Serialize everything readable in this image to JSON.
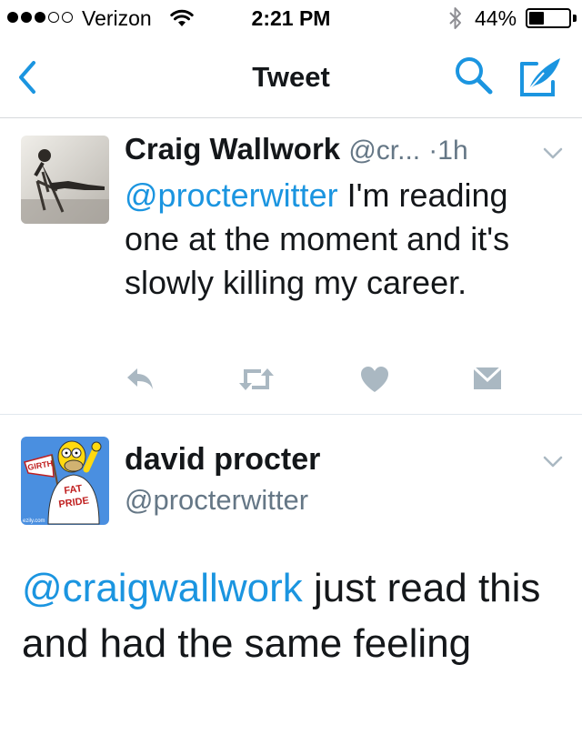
{
  "status_bar": {
    "signal_filled": 3,
    "signal_total": 5,
    "carrier": "Verizon",
    "time": "2:21 PM",
    "battery_percent_label": "44%",
    "battery_level": 0.44
  },
  "nav": {
    "title": "Tweet",
    "back_icon": "chevron-left-icon",
    "search_icon": "search-icon",
    "compose_icon": "compose-quill-icon"
  },
  "reply_tweet": {
    "author_name": "Craig Wallwork",
    "author_handle": "@cr...",
    "separator": "·",
    "time": "1h",
    "mention": "@procterwitter",
    "text": " I'm reading one at the moment and it's slowly killing my career.",
    "actions": [
      "reply-icon",
      "retweet-icon",
      "heart-icon",
      "direct-message-icon"
    ]
  },
  "main_tweet": {
    "author_name": "david procter",
    "author_handle": "@procterwitter",
    "mention": "@craigwallwork",
    "text": " just read this and had the same feeling",
    "avatar_texts": {
      "sign": "GIRTH",
      "shirt_line1": "FAT",
      "shirt_line2": "PRIDE",
      "watermark": "ezily.com"
    }
  },
  "colors": {
    "accent": "#1b95e0",
    "secondary_text": "#657786",
    "action_icon": "#aab8c2"
  }
}
